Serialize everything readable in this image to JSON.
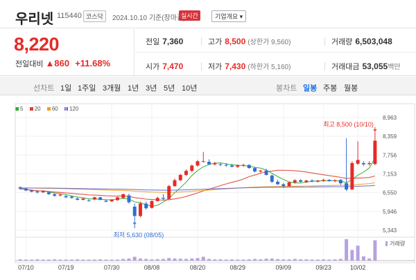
{
  "header": {
    "name": "우리넷",
    "code": "115440",
    "market": "코스닥",
    "date": "2024.10.10 기준(장마감)",
    "realtime": "실시간",
    "company_info": "기업개요 ▾"
  },
  "summary": {
    "price": "8,220",
    "change_label": "전일대비",
    "change_arrow": "▲",
    "change_value": "860",
    "change_pct": "+11.68%",
    "prev_label": "전일",
    "prev_value": "7,360",
    "high_label": "고가",
    "high_value": "8,500",
    "upper_label": "(상한가 9,560)",
    "volume_label": "거래량",
    "volume_value": "6,503,048",
    "open_label": "시가",
    "open_value": "7,470",
    "low_label": "저가",
    "low_value": "7,430",
    "lower_label": "(하한가 5,160)",
    "amount_label": "거래대금",
    "amount_value": "53,055",
    "amount_unit": "백만"
  },
  "tabs": {
    "line_label": "선차트",
    "periods": [
      "1일",
      "1주일",
      "3개월",
      "1년",
      "3년",
      "5년",
      "10년"
    ],
    "candle_label": "봉차트",
    "candle_types": [
      "일봉",
      "주봉",
      "월봉"
    ],
    "candle_selected": 0
  },
  "legend": [
    {
      "label": "5",
      "color": "#33aa33"
    },
    {
      "label": "20",
      "color": "#e04030"
    },
    {
      "label": "60",
      "color": "#f0a020"
    },
    {
      "label": "120",
      "color": "#6666cc"
    }
  ],
  "chart_data": {
    "type": "candlestick",
    "y_ticks": [
      "8,963",
      "8,359",
      "7,756",
      "7,153",
      "6,550",
      "5,946",
      "5,343"
    ],
    "ylim": [
      5343,
      8963
    ],
    "x_ticks": [
      "07/10",
      "07/19",
      "07/30",
      "08/08",
      "08/20",
      "08/29",
      "09/09",
      "09/23",
      "10/02"
    ],
    "annotations": {
      "high": "최고 8,500 (10/10)",
      "low": "최저 5,630 (08/05)"
    },
    "volume_label": "거래량",
    "candles": [
      [
        6720,
        6760,
        6640,
        6680
      ],
      [
        6680,
        6710,
        6600,
        6620
      ],
      [
        6620,
        6650,
        6560,
        6580
      ],
      [
        6590,
        6630,
        6520,
        6560
      ],
      [
        6560,
        6620,
        6540,
        6600
      ],
      [
        6560,
        6580,
        6480,
        6500
      ],
      [
        6500,
        6520,
        6420,
        6450
      ],
      [
        6460,
        6510,
        6430,
        6490
      ],
      [
        6440,
        6470,
        6380,
        6400
      ],
      [
        6420,
        6460,
        6360,
        6380
      ],
      [
        6360,
        6400,
        6300,
        6320
      ],
      [
        6320,
        6380,
        6300,
        6360
      ],
      [
        6300,
        6340,
        6260,
        6280
      ],
      [
        6330,
        6420,
        6310,
        6400
      ],
      [
        6400,
        6420,
        6300,
        6320
      ],
      [
        6290,
        6330,
        6240,
        6260
      ],
      [
        6270,
        6340,
        6250,
        6330
      ],
      [
        6310,
        6420,
        6290,
        6400
      ],
      [
        6380,
        6520,
        6360,
        6500
      ],
      [
        6460,
        6520,
        6200,
        6240
      ],
      [
        6100,
        6200,
        5630,
        5800
      ],
      [
        5800,
        6260,
        5760,
        6200
      ],
      [
        6200,
        6260,
        6000,
        6050
      ],
      [
        6060,
        6300,
        6040,
        6280
      ],
      [
        6280,
        6420,
        6260,
        6380
      ],
      [
        6380,
        6500,
        6300,
        6350
      ],
      [
        6350,
        6800,
        6330,
        6760
      ],
      [
        6760,
        7000,
        6740,
        6950
      ],
      [
        6950,
        7150,
        6920,
        7120
      ],
      [
        7120,
        7300,
        7080,
        7250
      ],
      [
        7250,
        7450,
        7200,
        7420
      ],
      [
        7420,
        7600,
        7380,
        7560
      ],
      [
        7560,
        7860,
        7520,
        7560
      ],
      [
        7540,
        7620,
        7440,
        7460
      ],
      [
        7460,
        7540,
        7420,
        7500
      ],
      [
        7460,
        7520,
        7400,
        7440
      ],
      [
        7440,
        7500,
        7380,
        7420
      ],
      [
        7420,
        7480,
        7360,
        7380
      ],
      [
        7380,
        7450,
        7340,
        7420
      ],
      [
        7420,
        7480,
        7380,
        7440
      ],
      [
        7440,
        7460,
        7320,
        7340
      ],
      [
        7340,
        7380,
        7200,
        7230
      ],
      [
        7230,
        7280,
        7180,
        7260
      ],
      [
        7260,
        7320,
        7100,
        7120
      ],
      [
        7100,
        7140,
        6860,
        6900
      ],
      [
        6900,
        6960,
        6800,
        6820
      ],
      [
        6820,
        6860,
        6700,
        6760
      ],
      [
        6760,
        6900,
        6740,
        6880
      ],
      [
        6880,
        6980,
        6840,
        6950
      ],
      [
        6950,
        6980,
        6880,
        6900
      ],
      [
        6890,
        6960,
        6860,
        6940
      ],
      [
        6940,
        6980,
        6880,
        6910
      ],
      [
        6900,
        6960,
        6880,
        6930
      ],
      [
        6930,
        7000,
        6900,
        6960
      ],
      [
        6960,
        6990,
        6900,
        6920
      ],
      [
        6920,
        6980,
        6880,
        6950
      ],
      [
        6960,
        6990,
        6800,
        6850
      ],
      [
        6850,
        8300,
        6600,
        6650
      ],
      [
        6650,
        7560,
        6640,
        7500
      ],
      [
        7480,
        8200,
        7440,
        7600
      ],
      [
        7500,
        7560,
        7400,
        7460
      ],
      [
        7470,
        7560,
        7420,
        7500
      ],
      [
        7470,
        8500,
        7430,
        8220
      ]
    ],
    "volumes": [
      6,
      5,
      5,
      6,
      5,
      5,
      6,
      5,
      5,
      5,
      6,
      5,
      5,
      5,
      6,
      5,
      5,
      5,
      8,
      10,
      18,
      10,
      8,
      6,
      7,
      8,
      12,
      10,
      9,
      8,
      10,
      12,
      18,
      8,
      6,
      6,
      5,
      6,
      5,
      5,
      6,
      8,
      6,
      9,
      10,
      7,
      6,
      6,
      8,
      6,
      6,
      5,
      5,
      6,
      5,
      6,
      8,
      100,
      50,
      70,
      20,
      10,
      95
    ]
  }
}
